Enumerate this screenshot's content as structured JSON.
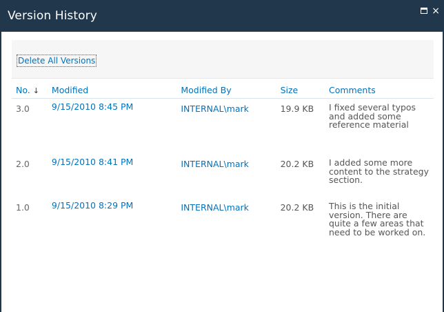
{
  "window": {
    "title": "Version History",
    "maximize_glyph": "",
    "close_glyph": "×"
  },
  "toolbar": {
    "delete_all_label": "Delete All Versions"
  },
  "table": {
    "headers": {
      "no": "No.",
      "sort_indicator": "↓",
      "modified": "Modified",
      "modified_by": "Modified By",
      "size": "Size",
      "comments": "Comments"
    },
    "rows": [
      {
        "no": "3.0",
        "modified": "9/15/2010 8:45 PM",
        "modified_by": "INTERNAL\\mark",
        "size": "19.9 KB",
        "comment": "I fixed several typos and added some reference material"
      },
      {
        "no": "2.0",
        "modified": "9/15/2010 8:41 PM",
        "modified_by": "INTERNAL\\mark",
        "size": "20.2 KB",
        "comment": "I added some more content to the strategy section."
      },
      {
        "no": "1.0",
        "modified": "9/15/2010 8:29 PM",
        "modified_by": "INTERNAL\\mark",
        "size": "20.2 KB",
        "comment": "This is the initial version. There are quite a few areas that need to be worked on."
      }
    ]
  },
  "colors": {
    "titlebar": "#21374c",
    "link": "#0072bc",
    "toolbar_bg": "#f6f6f6",
    "text": "#555555"
  }
}
